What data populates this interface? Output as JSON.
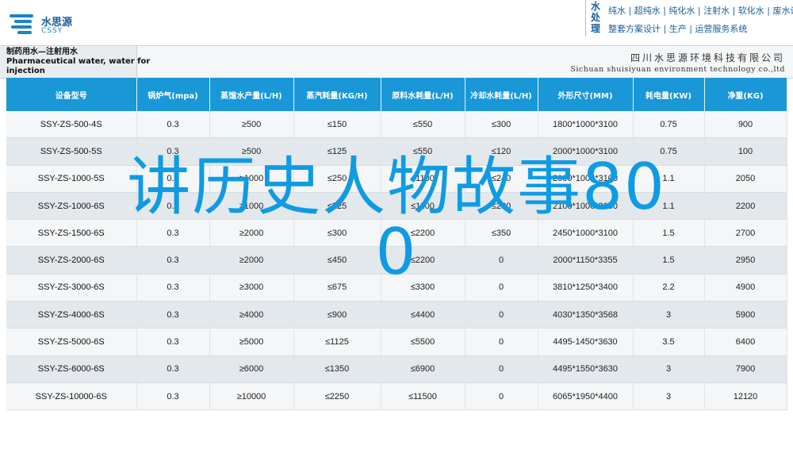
{
  "header": {
    "logo_cn": "水思源",
    "logo_en": "CSSY",
    "brand_vertical": "水处理",
    "services_line1": "纯水 | 超纯水 | 纯化水 | 注射水 | 软化水 | 废水设备",
    "services_line2": "整套方案设计 | 生产 | 运营服务系统"
  },
  "band": {
    "product_title_cn": "制药用水—注射用水",
    "product_title_en_1": "Pharmaceutical water, water for",
    "product_title_en_2": "injection",
    "company_cn": "四川水思源环境科技有限公司",
    "company_en": "Sichuan shuisiyuan environment technology co.,ltd"
  },
  "table": {
    "headers": [
      "设备型号",
      "锅炉气(mpa)",
      "蒸馏水产量(L/H)",
      "蒸汽耗量(KG/H)",
      "原料水耗量(L/H)",
      "冷却水耗量(L/H)",
      "外形尺寸(MM)",
      "耗电量(KW)",
      "净重(KG)"
    ],
    "rows": [
      [
        "SSY-ZS-500-4S",
        "0.3",
        "≥500",
        "≤150",
        "≤550",
        "≤300",
        "1800*1000*3100",
        "0.75",
        "900"
      ],
      [
        "SSY-ZS-500-5S",
        "0.3",
        "≥500",
        "≤125",
        "≤550",
        "≤120",
        "2000*1000*3100",
        "0.75",
        "100"
      ],
      [
        "SSY-ZS-1000-5S",
        "0.3",
        "≥1000",
        "≤250",
        "≤1100",
        "≤240",
        "2000*1000*3100",
        "1.1",
        "2050"
      ],
      [
        "SSY-ZS-1000-6S",
        "0.3",
        "≥1000",
        "≤225",
        "≤1100",
        "≤200",
        "2100*1000*3100",
        "1.1",
        "2200"
      ],
      [
        "SSY-ZS-1500-6S",
        "0.3",
        "≥2000",
        "≤300",
        "≤2200",
        "≤350",
        "2450*1000*3100",
        "1.5",
        "2700"
      ],
      [
        "SSY-ZS-2000-6S",
        "0.3",
        "≥2000",
        "≤450",
        "≤2200",
        "0",
        "2000*1150*3355",
        "1.5",
        "2950"
      ],
      [
        "SSY-ZS-3000-6S",
        "0.3",
        "≥3000",
        "≤675",
        "≤3300",
        "0",
        "3810*1250*3400",
        "2.2",
        "4900"
      ],
      [
        "SSY-ZS-4000-6S",
        "0.3",
        "≥4000",
        "≤900",
        "≤4400",
        "0",
        "4030*1350*3568",
        "3",
        "5900"
      ],
      [
        "SSY-ZS-5000-6S",
        "0.3",
        "≥5000",
        "≤1125",
        "≤5500",
        "0",
        "4495-1450*3630",
        "3.5",
        "6400"
      ],
      [
        "SSY-ZS-6000-6S",
        "0.3",
        "≥6000",
        "≤1350",
        "≤6900",
        "0",
        "4495*1550*3630",
        "3",
        "7900"
      ],
      [
        "SSY-ZS-10000-6S",
        "0.3",
        "≥10000",
        "≤2250",
        "≤11500",
        "0",
        "6065*1950*4400",
        "3",
        "12120"
      ]
    ]
  },
  "overlay": {
    "text": "讲历史人物故事80\n0"
  }
}
